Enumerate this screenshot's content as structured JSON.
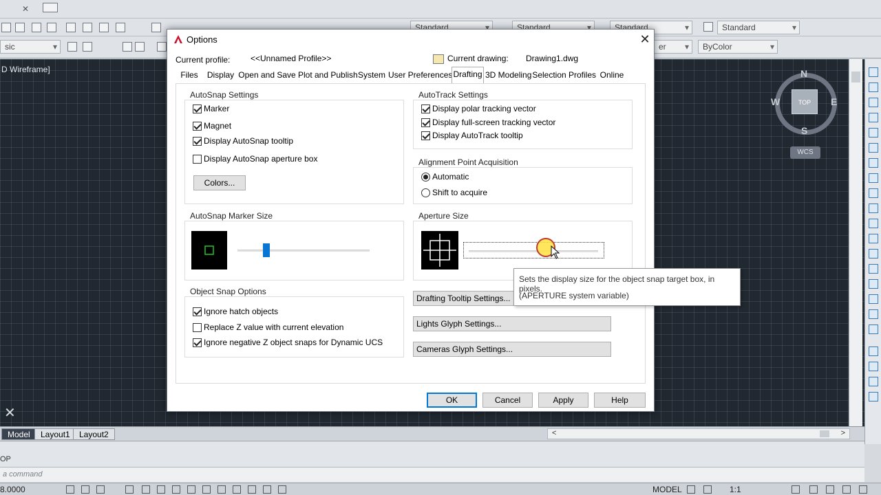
{
  "app": {
    "toolbar": {
      "text_style": "Standard",
      "dim_style": "Standard",
      "table_style": "Standard",
      "mleader_style": "Standard",
      "workspace_fragment": "sic",
      "color_fragment": "er",
      "color_value": "ByColor"
    },
    "viewport_label": "D Wireframe]",
    "viewcube": {
      "top": "TOP",
      "north": "N",
      "south": "S",
      "east": "E",
      "west": "W",
      "wcs": "WCS"
    },
    "layout_tabs": [
      "Model",
      "Layout1",
      "Layout2"
    ],
    "command_history": "OP",
    "command_placeholder": "a command",
    "status": {
      "coords": "8.0000",
      "model": "MODEL",
      "scale": "1:1"
    }
  },
  "dialog": {
    "title": "Options",
    "profile_label": "Current profile:",
    "profile_value": "<<Unnamed Profile>>",
    "drawing_label": "Current drawing:",
    "drawing_value": "Drawing1.dwg",
    "tabs": [
      "Files",
      "Display",
      "Open and Save",
      "Plot and Publish",
      "System",
      "User Preferences",
      "Drafting",
      "3D Modeling",
      "Selection",
      "Profiles",
      "Online"
    ],
    "active_tab": "Drafting",
    "autosnap": {
      "title": "AutoSnap Settings",
      "marker": "Marker",
      "magnet": "Magnet",
      "tooltip": "Display AutoSnap tooltip",
      "aperture_box": "Display AutoSnap aperture box",
      "colors_button": "Colors..."
    },
    "autotrack": {
      "title": "AutoTrack Settings",
      "polar": "Display polar tracking vector",
      "fullscreen": "Display full-screen tracking vector",
      "tooltip": "Display AutoTrack tooltip"
    },
    "alignment": {
      "title": "Alignment Point Acquisition",
      "automatic": "Automatic",
      "shift": "Shift to acquire"
    },
    "marker_size": {
      "title": "AutoSnap Marker Size",
      "value_fraction": 0.22
    },
    "aperture_size": {
      "title": "Aperture Size",
      "value_fraction": 0.6
    },
    "object_snap": {
      "title": "Object Snap Options",
      "ignore_hatch": "Ignore hatch objects",
      "replace_z": "Replace Z value with current elevation",
      "ignore_negative_z": "Ignore negative Z object snaps for Dynamic UCS"
    },
    "buttons": {
      "drafting_tooltip": "Drafting Tooltip Settings...",
      "lights_glyph": "Lights Glyph Settings...",
      "cameras_glyph": "Cameras Glyph Settings...",
      "ok": "OK",
      "cancel": "Cancel",
      "apply": "Apply",
      "help": "Help"
    },
    "tooltip": {
      "line1": "Sets the display size for the object snap target box, in pixels.",
      "line2": "(APERTURE system variable)"
    }
  }
}
